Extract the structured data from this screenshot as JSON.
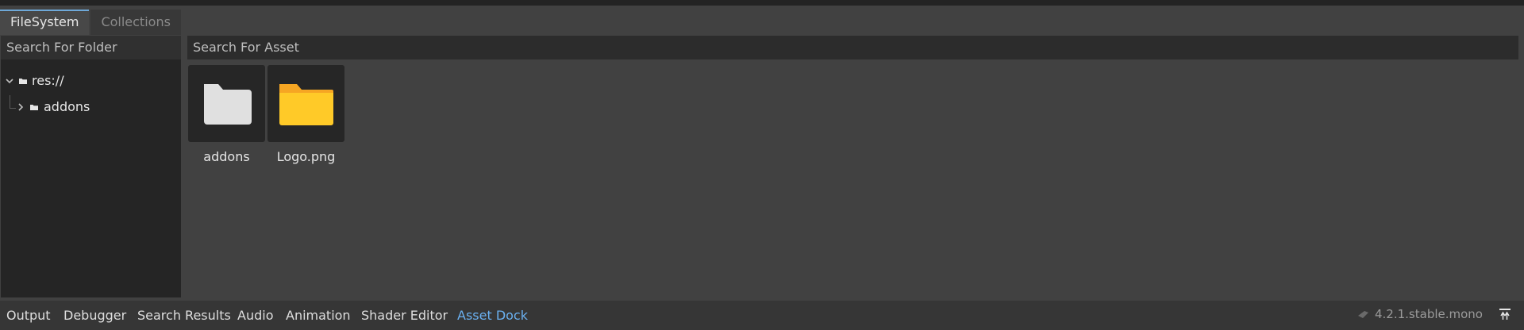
{
  "tabs": [
    {
      "label": "FileSystem",
      "active": true
    },
    {
      "label": "Collections",
      "active": false
    }
  ],
  "folder_search": {
    "placeholder": "Search For Folder"
  },
  "asset_search": {
    "placeholder": "Search For Asset"
  },
  "tree": {
    "root": {
      "label": "res://",
      "expanded": true,
      "icon": "folder-icon"
    },
    "children": [
      {
        "label": "addons",
        "expanded": false,
        "icon": "folder-icon"
      }
    ]
  },
  "assets": [
    {
      "label": "addons",
      "icon": "folder-icon",
      "color": "#e0e0e0"
    },
    {
      "label": "Logo.png",
      "icon": "folder-icon",
      "color": "#ffca28"
    }
  ],
  "bottom_tabs": [
    {
      "label": "Output",
      "active": false
    },
    {
      "label": "Debugger",
      "active": false
    },
    {
      "label": "Search Results",
      "active": false
    },
    {
      "label": "Audio",
      "active": false
    },
    {
      "label": "Animation",
      "active": false
    },
    {
      "label": "Shader Editor",
      "active": false
    },
    {
      "label": "Asset Dock",
      "active": true
    }
  ],
  "version": "4.2.1.stable.mono",
  "colors": {
    "accent": "#6ab0f0",
    "folder_yellow": "#ffca28"
  }
}
